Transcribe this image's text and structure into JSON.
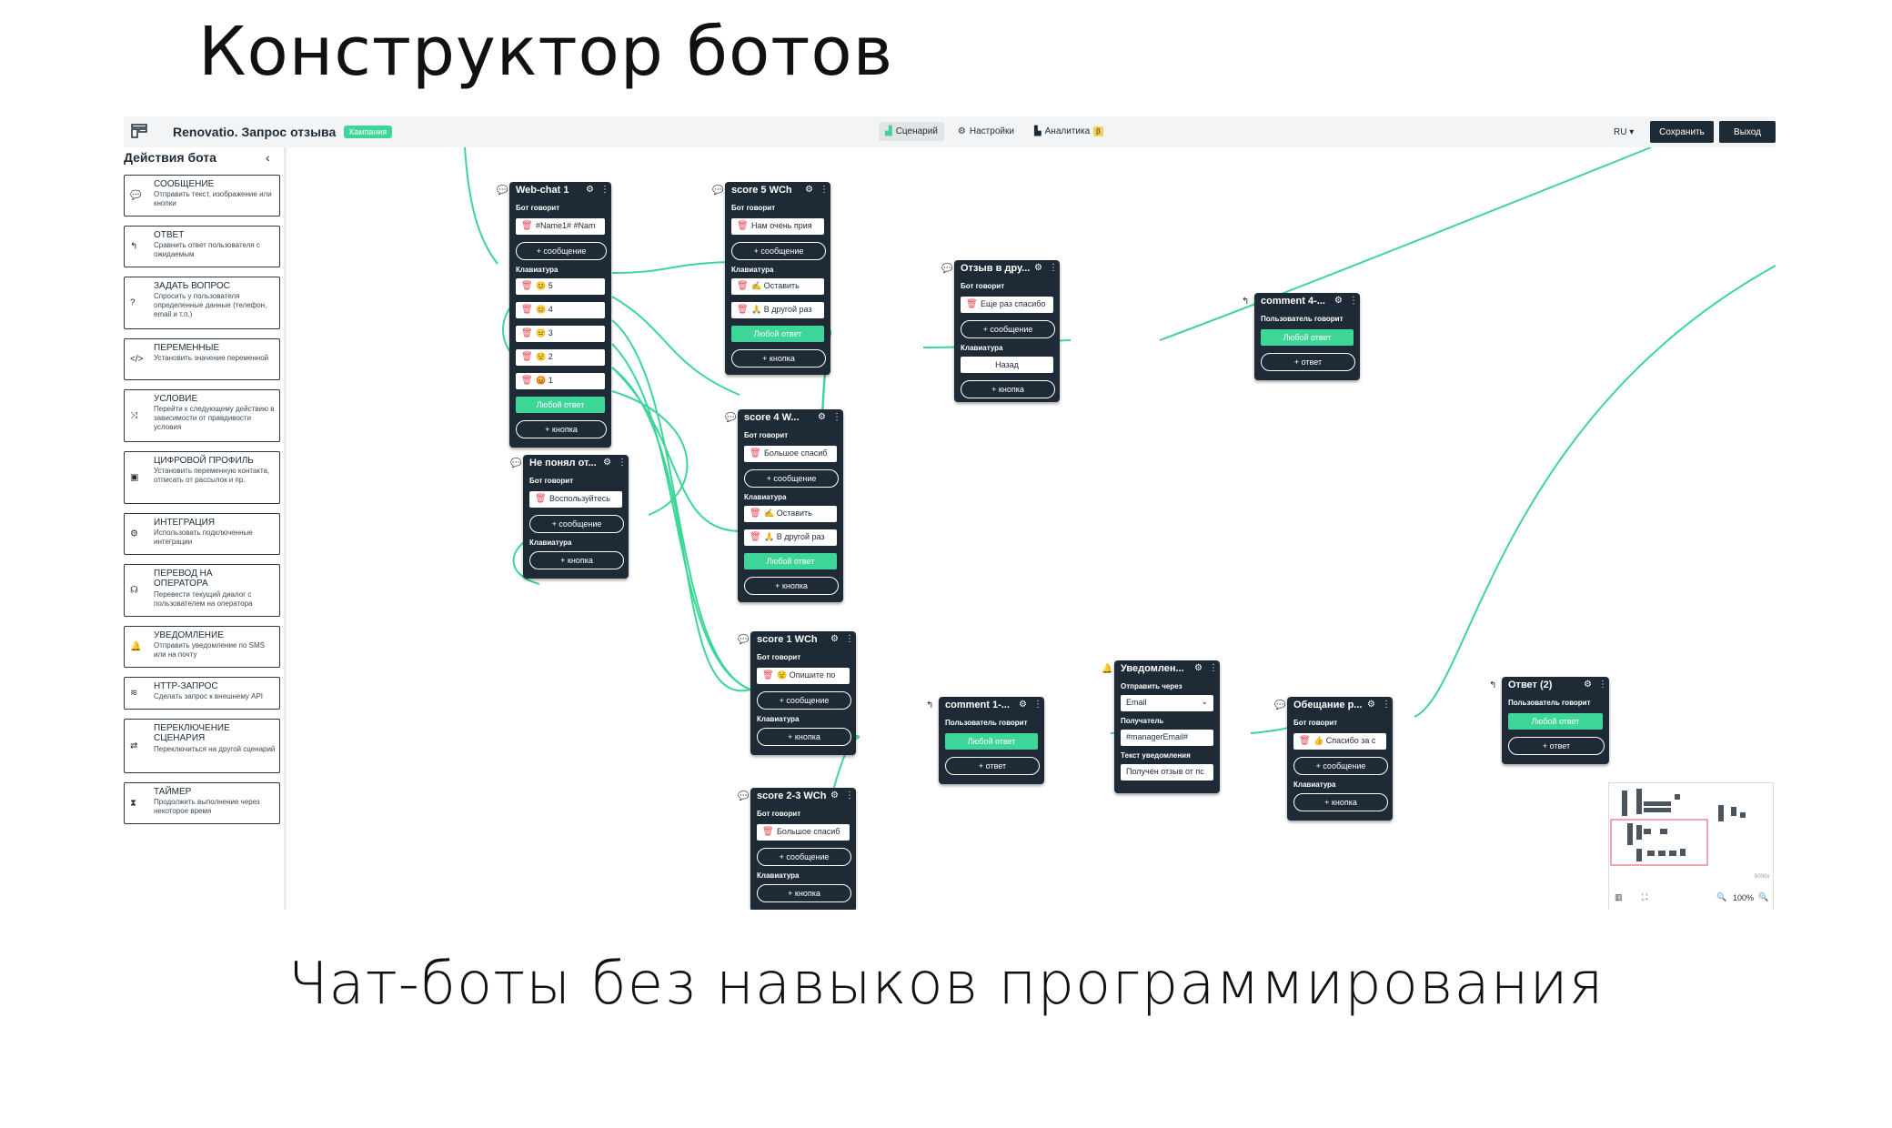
{
  "headline": "Конструктор ботов",
  "tagline": "Чат-боты без навыков программирования",
  "app": {
    "bot_title": "Renovatio. Запрос отзыва",
    "badge": "Кампания",
    "tabs": [
      {
        "label": "Сценарий",
        "icon": "scenario-icon",
        "active": true
      },
      {
        "label": "Настройки",
        "icon": "gear-icon"
      },
      {
        "label": "Аналитика",
        "icon": "chart-icon",
        "beta": "β"
      }
    ],
    "lang": "RU ▾",
    "save": "Сохранить",
    "exit": "Выход",
    "colors": {
      "dark": "#1e2b36",
      "green": "#3dd598",
      "delete": "#e44b5a"
    }
  },
  "sidebar": {
    "heading": "Действия бота",
    "collapse": "‹",
    "items": [
      {
        "title": "СООБЩЕНИЕ",
        "desc": "Отправить текст, изображение или кнопки",
        "icon": "💬"
      },
      {
        "title": "ОТВЕТ",
        "desc": "Сравнить ответ пользователя с ожидаемым",
        "icon": "↰"
      },
      {
        "title": "ЗАДАТЬ ВОПРОС",
        "desc": "Спросить у пользователя определенные данные (телефон, email и т.п.)",
        "icon": "?"
      },
      {
        "title": "ПЕРЕМЕННЫЕ",
        "desc": "Установить значение переменной",
        "icon": "</>"
      },
      {
        "title": "УСЛОВИЕ",
        "desc": "Перейти к следующему действию в зависимости от правдивости условия",
        "icon": "⤨"
      },
      {
        "title": "ЦИФРОВОЙ ПРОФИЛЬ",
        "desc": "Установить переменную контакта, отписать от рассылок и пр.",
        "icon": "▣"
      },
      {
        "title": "ИНТЕГРАЦИЯ",
        "desc": "Использовать подключенные интеграции",
        "icon": "⚙"
      },
      {
        "title": "ПЕРЕВОД НА ОПЕРАТОРА",
        "desc": "Перевести текущий диалог с пользователем на оператора",
        "icon": "☊"
      },
      {
        "title": "УВЕДОМЛЕНИЕ",
        "desc": "Отправить уведомление по SMS или на почту",
        "icon": "🔔"
      },
      {
        "title": "HTTP-ЗАПРОС",
        "desc": "Сделать запрос к внешнему API",
        "icon": "≋"
      },
      {
        "title": "ПЕРЕКЛЮЧЕНИЕ СЦЕНАРИЯ",
        "desc": "Переключиться на другой сценарий",
        "icon": "⇄"
      },
      {
        "title": "ТАЙМЕР",
        "desc": "Продолжить выполнение через некоторое время",
        "icon": "⧗"
      }
    ]
  },
  "nodes": {
    "webchat": {
      "title": "Web-chat 1",
      "says": "Бот говорит",
      "text": "#Name1# #Nam",
      "add_msg": "+ сообщение",
      "kb": "Клавиатура",
      "buttons": [
        "😊 5",
        "😊 4",
        "😐 3",
        "😟 2",
        "😡 1"
      ],
      "any": "Любой ответ",
      "add_btn": "+ кнопка"
    },
    "notunderstood": {
      "title": "Не понял от...",
      "says": "Бот говорит",
      "text": "Воспользуйтесь",
      "add_msg": "+ сообщение",
      "kb": "Клавиатура",
      "add_btn": "+ кнопка"
    },
    "score5": {
      "title": "score 5 WCh",
      "says": "Бот говорит",
      "text": "Нам очень прия",
      "add_msg": "+ сообщение",
      "kb": "Клавиатура",
      "buttons": [
        "✍ Оставить",
        "🙏 В другой раз"
      ],
      "any": "Любой ответ",
      "add_btn": "+ кнопка"
    },
    "score4": {
      "title": "score 4 W...",
      "says": "Бот говорит",
      "text": "Большое спасиб",
      "add_msg": "+ сообщение",
      "kb": "Клавиатура",
      "buttons": [
        "✍ Оставить",
        "🙏 В другой раз"
      ],
      "any": "Любой ответ",
      "add_btn": "+ кнопка"
    },
    "review": {
      "title": "Отзыв в дру...",
      "says": "Бот говорит",
      "text": "Еще раз спасибо",
      "add_msg": "+ сообщение",
      "kb": "Клавиатура",
      "back": "Назад",
      "add_btn": "+ кнопка"
    },
    "comment4": {
      "title": "comment 4-...",
      "user_says": "Пользователь говорит",
      "any": "Любой ответ",
      "add_answer": "+ ответ"
    },
    "score1": {
      "title": "score 1 WCh",
      "says": "Бот говорит",
      "text": "😟 Опишите по",
      "add_msg": "+ сообщение",
      "kb": "Клавиатура",
      "add_btn": "+ кнопка"
    },
    "score23": {
      "title": "score 2-3 WCh",
      "says": "Бот говорит",
      "text": "Большое спасиб",
      "add_msg": "+ сообщение",
      "kb": "Клавиатура",
      "add_btn": "+ кнопка"
    },
    "comment1": {
      "title": "comment 1-...",
      "user_says": "Пользователь говорит",
      "any": "Любой ответ",
      "add_answer": "+ ответ"
    },
    "notify": {
      "title": "Уведомлен...",
      "send_via": "Отправить через",
      "channel": "Email",
      "recipient_lbl": "Получатель",
      "recipient": "#managerEmail#",
      "text_lbl": "Текст уведомления",
      "text": "Получен отзыв от пс"
    },
    "promise": {
      "title": "Обещание р...",
      "says": "Бот говорит",
      "text": "👍 Спасибо за с",
      "add_msg": "+ сообщение",
      "kb": "Клавиатура",
      "add_btn": "+ кнопка"
    },
    "answer2": {
      "title": "Ответ (2)",
      "user_says": "Пользователь говорит",
      "any": "Любой ответ",
      "add_answer": "+ ответ"
    }
  },
  "minimap": {
    "zoom": "100%",
    "scale": "5000x"
  }
}
